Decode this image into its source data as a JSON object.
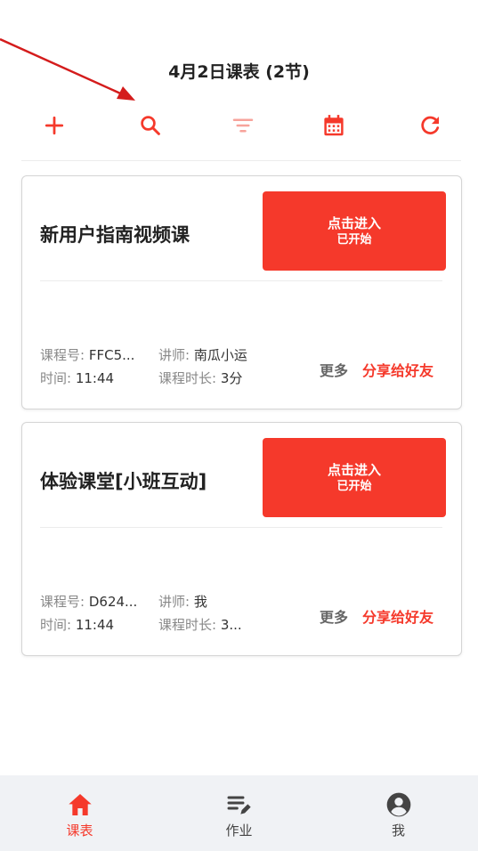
{
  "header": {
    "title": "4月2日课表 (2节)"
  },
  "toolbar": {
    "accent": "#f5392b",
    "icons": [
      "plus-icon",
      "search-icon",
      "filter-icon",
      "calendar-icon",
      "refresh-icon"
    ]
  },
  "courses": [
    {
      "title": "新用户指南视频课",
      "enter_label": "点击进入",
      "status": "已开始",
      "course_no_label": "课程号:",
      "course_no": "FFC5...",
      "teacher_label": "讲师:",
      "teacher": "南瓜小运",
      "time_label": "时间:",
      "time": "11:44",
      "duration_label": "课程时长:",
      "duration": "3分",
      "more": "更多",
      "share": "分享给好友"
    },
    {
      "title": "体验课堂[小班互动]",
      "enter_label": "点击进入",
      "status": "已开始",
      "course_no_label": "课程号:",
      "course_no": "D624...",
      "teacher_label": "讲师:",
      "teacher": "我",
      "time_label": "时间:",
      "time": "11:44",
      "duration_label": "课程时长:",
      "duration": "3...",
      "more": "更多",
      "share": "分享给好友"
    }
  ],
  "tabbar": {
    "items": [
      {
        "label": "课表",
        "icon": "home-icon",
        "active": true
      },
      {
        "label": "作业",
        "icon": "homework-icon",
        "active": false
      },
      {
        "label": "我",
        "icon": "profile-icon",
        "active": false
      }
    ],
    "active_color": "#f5392b",
    "inactive_color": "#444444"
  }
}
